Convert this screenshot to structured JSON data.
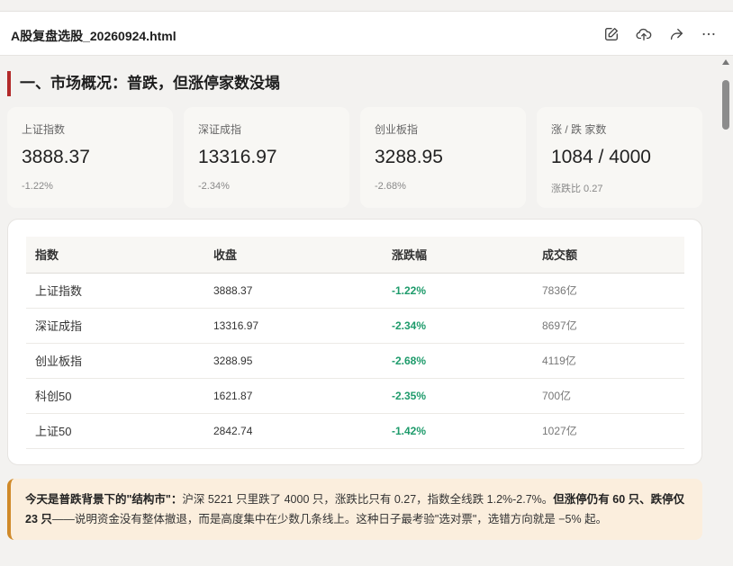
{
  "header": {
    "filename": "A股复盘选股_20260924.html",
    "icons": [
      "edit-icon",
      "upload-icon",
      "share-icon",
      "more-icon"
    ]
  },
  "section": {
    "title": "一、市场概况：普跌，但涨停家数没塌"
  },
  "cards": [
    {
      "label": "上证指数",
      "value": "3888.37",
      "sub": "-1.22%"
    },
    {
      "label": "深证成指",
      "value": "13316.97",
      "sub": "-2.34%"
    },
    {
      "label": "创业板指",
      "value": "3288.95",
      "sub": "-2.68%"
    },
    {
      "label": "涨 / 跌 家数",
      "value": "1084 / 4000",
      "sub": "涨跌比 0.27"
    }
  ],
  "table": {
    "headers": [
      "指数",
      "收盘",
      "涨跌幅",
      "成交额"
    ],
    "rows": [
      [
        "上证指数",
        "3888.37",
        "-1.22%",
        "7836亿"
      ],
      [
        "深证成指",
        "13316.97",
        "-2.34%",
        "8697亿"
      ],
      [
        "创业板指",
        "3288.95",
        "-2.68%",
        "4119亿"
      ],
      [
        "科创50",
        "1621.87",
        "-2.35%",
        "700亿"
      ],
      [
        "上证50",
        "2842.74",
        "-1.42%",
        "1027亿"
      ]
    ]
  },
  "note": {
    "bold1": "今天是普跌背景下的\"结构市\"：",
    "text1": "沪深 5221 只里跌了 4000 只，涨跌比只有 0.27，指数全线跌 1.2%-2.7%。",
    "bold2": "但涨停仍有 60 只、跌停仅 23 只",
    "text2": "——说明资金没有整体撤退，而是高度集中在少数几条线上。这种日子最考验\"选对票\"，选错方向就是 −5% 起。"
  },
  "colors": {
    "accent_red": "#b22a2a",
    "up_down_green": "#1e9b6b",
    "note_border": "#d08a2a"
  }
}
